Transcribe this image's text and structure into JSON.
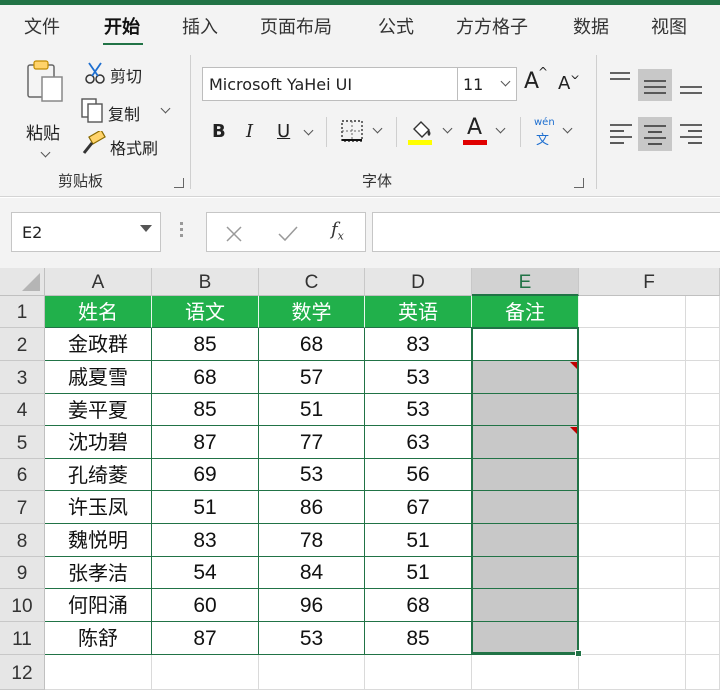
{
  "ribbon_tabs": [
    "文件",
    "开始",
    "插入",
    "页面布局",
    "公式",
    "方方格子",
    "数据",
    "视图"
  ],
  "active_tab": "开始",
  "clipboard": {
    "paste_label": "粘贴",
    "cut_label": "剪切",
    "copy_label": "复制",
    "format_painter_label": "格式刷",
    "group_label": "剪贴板"
  },
  "font": {
    "font_name": "Microsoft YaHei UI",
    "font_size": "11",
    "bold_label": "B",
    "italic_label": "I",
    "underline_label": "U",
    "group_label": "字体",
    "highlight_color": "#ffff00",
    "font_color": "#e00000",
    "phonetic_top": "wén",
    "phonetic_bottom": "文"
  },
  "formula_bar": {
    "name_box": "E2",
    "formula": ""
  },
  "sheet": {
    "columns": [
      "A",
      "B",
      "C",
      "D",
      "E",
      "F"
    ],
    "selected_column": "E",
    "rows": [
      "1",
      "2",
      "3",
      "4",
      "5",
      "6",
      "7",
      "8",
      "9",
      "10",
      "11",
      "12"
    ],
    "header": [
      "姓名",
      "语文",
      "数学",
      "英语",
      "备注"
    ],
    "data": [
      [
        "金政群",
        "85",
        "68",
        "83"
      ],
      [
        "戚夏雪",
        "68",
        "57",
        "53"
      ],
      [
        "姜平夏",
        "85",
        "51",
        "53"
      ],
      [
        "沈功碧",
        "87",
        "77",
        "63"
      ],
      [
        "孔绮菱",
        "69",
        "53",
        "56"
      ],
      [
        "许玉凤",
        "51",
        "86",
        "67"
      ],
      [
        "魏悦明",
        "83",
        "78",
        "51"
      ],
      [
        "张孝洁",
        "54",
        "84",
        "51"
      ],
      [
        "何阳涌",
        "60",
        "96",
        "68"
      ],
      [
        "陈舒",
        "87",
        "53",
        "85"
      ]
    ],
    "header_color": "#21b04b",
    "selection_color": "#217346"
  }
}
